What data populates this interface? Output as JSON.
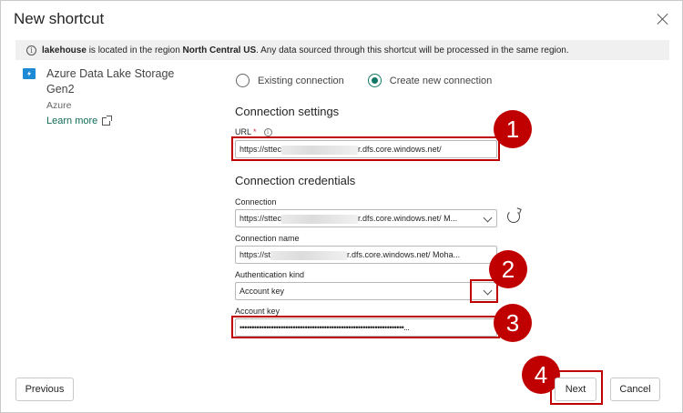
{
  "dialog": {
    "title": "New shortcut",
    "close_icon": "close-icon"
  },
  "banner": {
    "icon": "info-icon",
    "bold_text": "lakehouse",
    "text_1": " is located in the region ",
    "region": "North Central US",
    "text_2": ". Any data sourced through this shortcut will be processed in the same region."
  },
  "source": {
    "icon": "azure-data-lake-icon",
    "name": "Azure Data Lake Storage Gen2",
    "provider": "Azure",
    "learn_more": "Learn more"
  },
  "connection_mode": {
    "options": [
      {
        "label": "Existing connection",
        "selected": false
      },
      {
        "label": "Create new connection",
        "selected": true
      }
    ]
  },
  "connection_settings": {
    "heading": "Connection settings",
    "url_label": "URL",
    "url_required": "*",
    "url_prefix": "https://sttec",
    "url_suffix": "r.dfs.core.windows.net/"
  },
  "connection_credentials": {
    "heading": "Connection credentials",
    "connection_label": "Connection",
    "connection_prefix": "https://sttec",
    "connection_suffix": "r.dfs.core.windows.net/ M...",
    "connection_name_label": "Connection name",
    "connection_name_prefix": "https://st",
    "connection_name_suffix": "r.dfs.core.windows.net/ Moha...",
    "auth_kind_label": "Authentication kind",
    "auth_kind_value": "Account key",
    "account_key_label": "Account key",
    "account_key_value": "••••••••••••••••••••••••••••••••••••••••••••••••••••••••••••••••••••..."
  },
  "callouts": [
    "1",
    "2",
    "3",
    "4"
  ],
  "footer": {
    "previous": "Previous",
    "next": "Next",
    "cancel": "Cancel"
  },
  "colors": {
    "accent": "#117865",
    "callout": "#c00000",
    "link": "#0f6b55"
  }
}
